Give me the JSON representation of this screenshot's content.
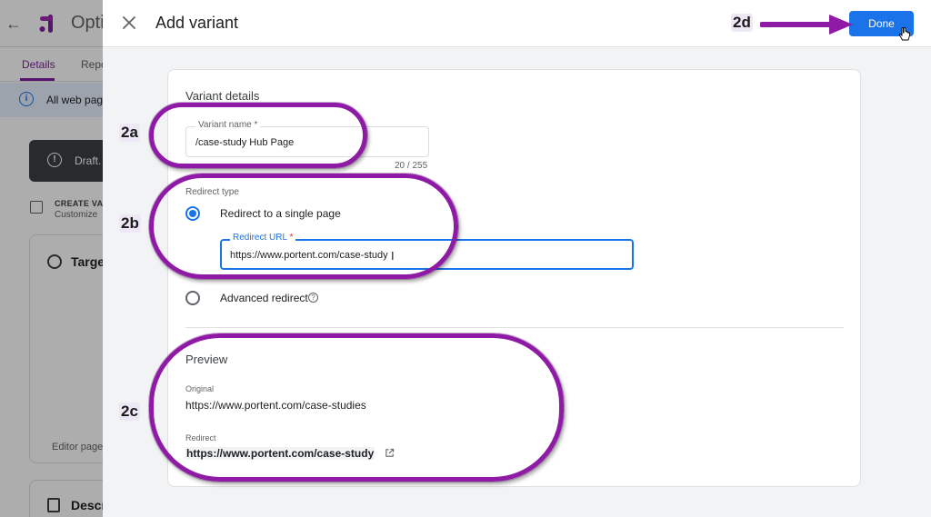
{
  "background": {
    "app_title": "Opti",
    "tabs": [
      "Details",
      "Repo"
    ],
    "info_text": "All web page",
    "draft_text": "Draft.",
    "create_title": "CREATE VA",
    "create_sub": "Customize",
    "target_title": "Target",
    "editor_text": "Editor page",
    "desc_title": "Descr"
  },
  "drawer": {
    "title": "Add variant",
    "done_label": "Done"
  },
  "variant_details": {
    "section_title": "Variant details",
    "name_label": "Variant name *",
    "name_value": "/case-study Hub Page",
    "char_count": "20 / 255",
    "redirect_type_label": "Redirect type",
    "option_single": "Redirect to a single page",
    "url_label": "Redirect URL",
    "url_required": "*",
    "url_value": "https://www.portent.com/case-study",
    "option_advanced": "Advanced redirect"
  },
  "preview": {
    "title": "Preview",
    "original_label": "Original",
    "original_url": "https://www.portent.com/case-studies",
    "redirect_label": "Redirect",
    "redirect_url": "https://www.portent.com/case-study"
  },
  "annotations": {
    "label_2a": "2a",
    "label_2b": "2b",
    "label_2c": "2c",
    "label_2d": "2d",
    "accent_color": "#8e1aa5"
  },
  "colors": {
    "primary": "#1a73e8",
    "brand": "#7b1fa2"
  }
}
